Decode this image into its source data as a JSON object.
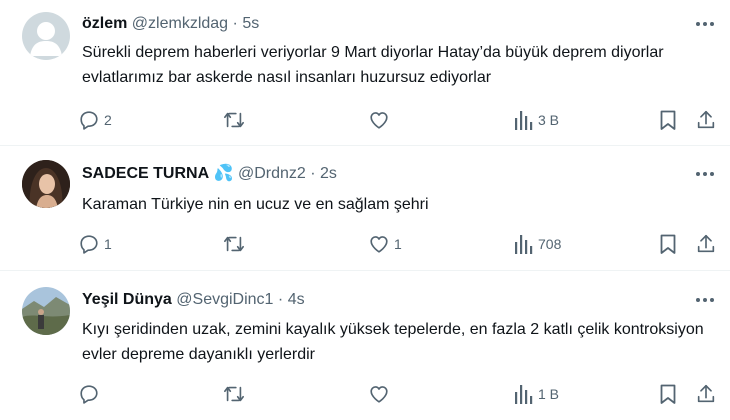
{
  "tweets": [
    {
      "name": "özlem",
      "handle": "@zlemkzldag",
      "dot": "·",
      "time": "5s",
      "text": "Sürekli deprem haberleri veriyorlar 9 Mart diyorlar Hatay’da büyük deprem diyorlar evlatlarımız bar askerde nasıl insanları huzursuz ediyorlar",
      "replies": "2",
      "retweets": "",
      "likes": "",
      "views": "3 B"
    },
    {
      "name": "SADECE TURNA",
      "emoji": "💦",
      "handle": "@Drdnz2",
      "dot": "·",
      "time": "2s",
      "text": "Karaman Türkiye nin en ucuz ve en sağlam şehri",
      "replies": "1",
      "retweets": "",
      "likes": "1",
      "views": "708"
    },
    {
      "name": "Yeşil Dünya",
      "handle": "@SevgiDinc1",
      "dot": "·",
      "time": "4s",
      "text": "Kıyı şeridinden uzak, zemini kayalık yüksek tepelerde, en fazla 2 katlı çelik kontroksiyon evler depreme dayanıklı yerlerdir",
      "replies": "",
      "retweets": "",
      "likes": "",
      "views": "1 B"
    }
  ],
  "colors": {
    "text": "#0f1419",
    "secondary": "#536471",
    "divider": "#eff3f4",
    "emoji_blue": "#5aa9e6"
  },
  "icons": [
    "more-icon",
    "reply-icon",
    "retweet-icon",
    "like-icon",
    "views-icon",
    "bookmark-icon",
    "share-icon",
    "default-avatar-icon",
    "sweat-droplets-icon"
  ]
}
